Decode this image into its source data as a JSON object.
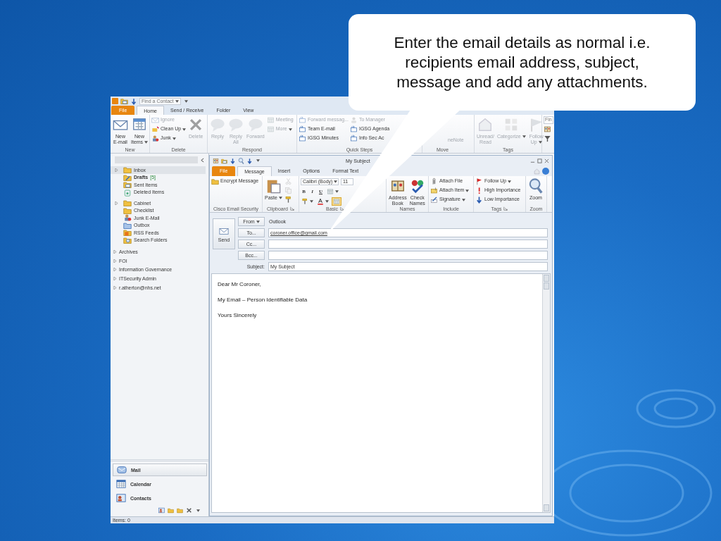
{
  "callout": {
    "text": "Enter the email details as normal i.e. recipients email address, subject, message and add any attachments."
  },
  "outlook": {
    "quick_access": {
      "find_contact": "Find a Contact"
    },
    "tabs": [
      {
        "label": "File",
        "kind": "file",
        "selected": false
      },
      {
        "label": "Home",
        "kind": "tab",
        "selected": true
      },
      {
        "label": "Send / Receive",
        "kind": "tab",
        "selected": false
      },
      {
        "label": "Folder",
        "kind": "tab",
        "selected": false
      },
      {
        "label": "View",
        "kind": "tab",
        "selected": false
      }
    ],
    "ribbon": [
      {
        "label": "New",
        "items": [
          {
            "kind": "large",
            "label": "New\nE-mail",
            "disabled": false
          },
          {
            "kind": "large",
            "label": "New\nItems",
            "disabled": false,
            "dropdown": true
          }
        ]
      },
      {
        "label": "Delete",
        "items": [
          {
            "kind": "small",
            "label": "Ignore",
            "disabled": true
          },
          {
            "kind": "small",
            "label": "Clean Up",
            "disabled": false,
            "dropdown": true
          },
          {
            "kind": "small",
            "label": "Junk",
            "disabled": false,
            "dropdown": true
          },
          {
            "kind": "large",
            "label": "Delete",
            "disabled": true
          }
        ]
      },
      {
        "label": "Respond",
        "items": [
          {
            "kind": "large",
            "label": "Reply",
            "disabled": true
          },
          {
            "kind": "large",
            "label": "Reply\nAll",
            "disabled": true
          },
          {
            "kind": "large",
            "label": "Forward",
            "disabled": true
          },
          {
            "kind": "small",
            "label": "Meeting",
            "disabled": true
          },
          {
            "kind": "small",
            "label": "More",
            "disabled": true,
            "dropdown": true
          }
        ]
      },
      {
        "label": "Quick Steps",
        "items": [
          {
            "kind": "small",
            "label": "Forward messag...",
            "disabled": true
          },
          {
            "kind": "small",
            "label": "Team E-mail",
            "disabled": false
          },
          {
            "kind": "small",
            "label": "IGSG Minutes",
            "disabled": false
          },
          {
            "kind": "small",
            "label": "To Manager",
            "disabled": true
          },
          {
            "kind": "small",
            "label": "IGSG Agenda",
            "disabled": false
          },
          {
            "kind": "small",
            "label": "Info Sec Ac",
            "disabled": false
          }
        ]
      },
      {
        "label": "Move",
        "items": [
          {
            "kind": "small",
            "label": "neNote",
            "disabled": true
          }
        ]
      },
      {
        "label": "Tags",
        "items": [
          {
            "kind": "large",
            "label": "Unread/\nRead",
            "disabled": true
          },
          {
            "kind": "large",
            "label": "Categorize",
            "disabled": true,
            "dropdown": true
          },
          {
            "kind": "large",
            "label": "Follow\nUp",
            "disabled": true,
            "dropdown": true
          }
        ]
      },
      {
        "kind": "find",
        "field": "Fin",
        "items": [
          {
            "kind": "small",
            "disabled": false
          },
          {
            "kind": "small",
            "disabled": false
          }
        ]
      }
    ],
    "folders": [
      {
        "name": "Inbox",
        "selected": true,
        "expanded": false
      },
      {
        "name": "Drafts",
        "count": "[5]",
        "selected": false,
        "unread": true
      },
      {
        "name": "Sent Items",
        "selected": false
      },
      {
        "name": "Deleted Items",
        "selected": false
      },
      {
        "name": "Cabinet",
        "selected": false,
        "expanded": false
      },
      {
        "name": "Checklist",
        "selected": false
      },
      {
        "name": "Junk E-Mail",
        "selected": false
      },
      {
        "name": "Outbox",
        "selected": false
      },
      {
        "name": "RSS Feeds",
        "selected": false
      },
      {
        "name": "Search Folders",
        "selected": false
      }
    ],
    "mailboxes": [
      {
        "name": "Archives",
        "expanded": false
      },
      {
        "name": "FOI",
        "expanded": false
      },
      {
        "name": "Information Governance",
        "expanded": false
      },
      {
        "name": "ITSecurity Admin",
        "expanded": false
      },
      {
        "name": "r.atherton@nhs.net",
        "expanded": false
      }
    ],
    "nav_buttons": [
      {
        "label": "Mail",
        "selected": true
      },
      {
        "label": "Calendar",
        "selected": false
      },
      {
        "label": "Contacts",
        "selected": false
      }
    ],
    "status_bar": {
      "items": "Items: 0"
    }
  },
  "message": {
    "title": "My Subject",
    "tabs": [
      {
        "label": "File",
        "kind": "file",
        "selected": false
      },
      {
        "label": "Message",
        "kind": "tab",
        "selected": true
      },
      {
        "label": "Insert",
        "kind": "tab",
        "selected": false
      },
      {
        "label": "Options",
        "kind": "tab",
        "selected": false
      },
      {
        "label": "Format Text",
        "kind": "tab",
        "selected": false
      }
    ],
    "ribbon": [
      {
        "label": "Cisco Email Security",
        "items": [
          {
            "kind": "small",
            "label": "Encrypt Message",
            "disabled": false
          }
        ]
      },
      {
        "label": "Clipboard",
        "launcher": true,
        "items": [
          {
            "kind": "large",
            "label": "Paste",
            "disabled": false,
            "dropdown": true
          },
          {
            "kind": "small",
            "disabled": true
          },
          {
            "kind": "small",
            "disabled": true
          },
          {
            "kind": "small",
            "disabled": false
          }
        ]
      },
      {
        "label": "Basic",
        "launcher": true,
        "kind": "basic_text",
        "font": "Calibri (Body)",
        "size": "11",
        "buttons": [
          "B",
          "I",
          "U"
        ]
      },
      {
        "label": "Names",
        "items": [
          {
            "kind": "large",
            "label": "Address\nBook",
            "disabled": false
          },
          {
            "kind": "large",
            "label": "Check\nNames",
            "disabled": false
          }
        ]
      },
      {
        "label": "Include",
        "items": [
          {
            "kind": "small",
            "label": "Attach File",
            "disabled": false
          },
          {
            "kind": "small",
            "label": "Attach Item",
            "disabled": false,
            "dropdown": true
          },
          {
            "kind": "small",
            "label": "Signature",
            "disabled": false,
            "dropdown": true
          }
        ]
      },
      {
        "label": "Tags",
        "launcher": true,
        "items": [
          {
            "kind": "small",
            "label": "Follow Up",
            "disabled": false,
            "dropdown": true
          },
          {
            "kind": "small",
            "label": "High Importance",
            "disabled": false
          },
          {
            "kind": "small",
            "label": "Low Importance",
            "disabled": false
          }
        ]
      },
      {
        "label": "Zoom",
        "items": [
          {
            "kind": "large",
            "label": "Zoom",
            "disabled": false
          }
        ]
      }
    ],
    "send": "Send",
    "fields": [
      {
        "kind": "from",
        "button": "From",
        "value": "Outlook"
      },
      {
        "kind": "address",
        "button": "To...",
        "value": "coroner.office@gmail.com"
      },
      {
        "kind": "address",
        "button": "Cc..."
      },
      {
        "kind": "address",
        "button": "Bcc..."
      },
      {
        "kind": "subject",
        "label": "Subject:",
        "value": "My Subject"
      }
    ],
    "body": [
      "Dear Mr Coroner,",
      "My Email – Person Identifiable Data",
      "Yours Sincerely"
    ]
  }
}
